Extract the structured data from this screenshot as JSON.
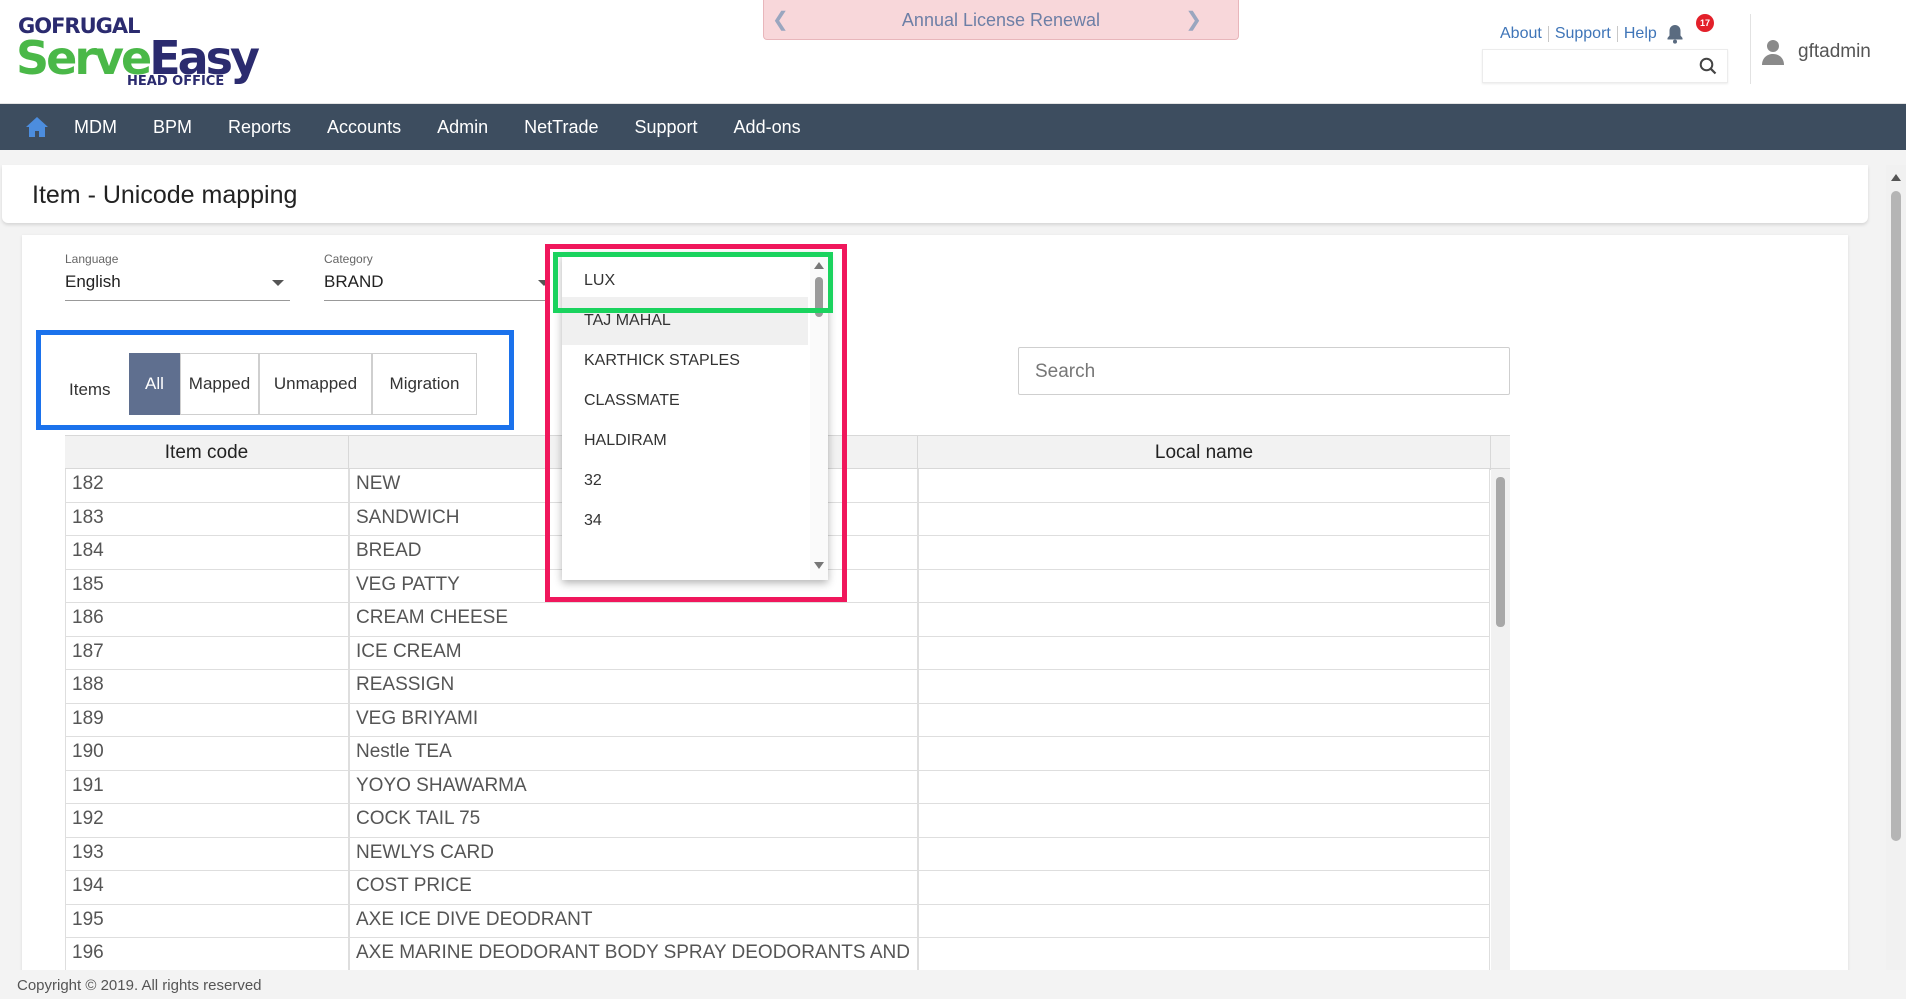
{
  "header": {
    "logo": {
      "top": "GOFRUGAL",
      "serve": "Serve",
      "easy": "Easy",
      "sub": "HEAD OFFICE"
    },
    "license_banner": "Annual License Renewal",
    "links": [
      "About",
      "Support",
      "Help"
    ],
    "notification_count": "17",
    "search_placeholder": "",
    "username": "gftadmin"
  },
  "nav": {
    "items": [
      "MDM",
      "BPM",
      "Reports",
      "Accounts",
      "Admin",
      "NetTrade",
      "Support",
      "Add-ons"
    ]
  },
  "page": {
    "title": "Item - Unicode mapping",
    "language": {
      "label": "Language",
      "value": "English"
    },
    "category": {
      "label": "Category",
      "value": "BRAND"
    },
    "filter": {
      "label": "Items",
      "segments": [
        "All",
        "Mapped",
        "Unmapped",
        "Migration"
      ],
      "active": "All"
    },
    "search_placeholder": "Search"
  },
  "dropdown": {
    "options": [
      "LUX",
      "TAJ MAHAL",
      "KARTHICK STAPLES",
      "CLASSMATE",
      "HALDIRAM",
      "32",
      "34"
    ],
    "selected": "LUX",
    "hovered": "TAJ MAHAL"
  },
  "table": {
    "headers": [
      "Item code",
      "",
      "Local name"
    ],
    "rows": [
      [
        "182",
        "NEW",
        ""
      ],
      [
        "183",
        "SANDWICH",
        ""
      ],
      [
        "184",
        "BREAD",
        ""
      ],
      [
        "185",
        "VEG PATTY",
        ""
      ],
      [
        "186",
        "CREAM CHEESE",
        ""
      ],
      [
        "187",
        "ICE CREAM",
        ""
      ],
      [
        "188",
        "REASSIGN",
        ""
      ],
      [
        "189",
        "VEG BRIYAMI",
        ""
      ],
      [
        "190",
        "Nestle TEA",
        ""
      ],
      [
        "191",
        "YOYO SHAWARMA",
        ""
      ],
      [
        "192",
        "COCK TAIL 75",
        ""
      ],
      [
        "193",
        "NEWLYS CARD",
        ""
      ],
      [
        "194",
        "COST PRICE",
        ""
      ],
      [
        "195",
        "AXE ICE DIVE DEODRANT",
        ""
      ],
      [
        "196",
        "AXE MARINE DEODORANT BODY SPRAY DEODORANTS AND",
        ""
      ]
    ]
  },
  "footer": {
    "copyright": "Copyright © 2019. All rights reserved"
  },
  "colors": {
    "nav_bg": "#3d4d5f",
    "active_segment": "#5f6f8f",
    "brand_green": "#4ab848",
    "brand_navy": "#2b2b6f"
  }
}
